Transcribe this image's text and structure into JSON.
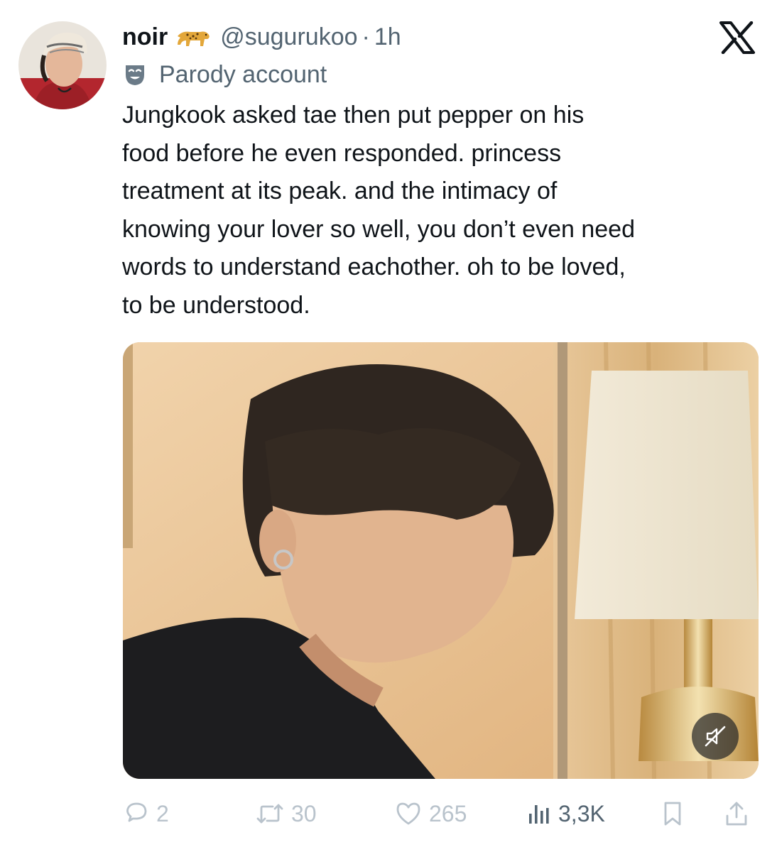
{
  "author": {
    "display_name": "noir",
    "badge_icon": "leopard-emoji-icon",
    "handle": "@sugurukoo",
    "separator": "·",
    "time_ago": "1h",
    "label_icon": "theater-mask-icon",
    "label": "Parody account"
  },
  "platform_logo": "x-logo-icon",
  "tweet": {
    "text": "Jungkook asked tae then put pepper on his\nfood before he even responded. princess\ntreatment at its peak. and the intimacy of\nknowing your lover so well, you don’t even need\nwords to understand eachother. oh to be loved,\nto be understood."
  },
  "media": {
    "type": "video",
    "mute_icon": "speaker-muted-icon"
  },
  "actions": {
    "reply": {
      "icon": "reply-icon",
      "count": "2"
    },
    "repost": {
      "icon": "repost-icon",
      "count": "30"
    },
    "like": {
      "icon": "heart-icon",
      "count": "265"
    },
    "views": {
      "icon": "views-icon",
      "count": "3,3K"
    },
    "bookmark": {
      "icon": "bookmark-icon"
    },
    "share": {
      "icon": "share-icon"
    }
  },
  "colors": {
    "text_primary": "#0f1419",
    "text_secondary": "#536471",
    "faded_action": "#b9c3cc",
    "background": "#ffffff"
  }
}
